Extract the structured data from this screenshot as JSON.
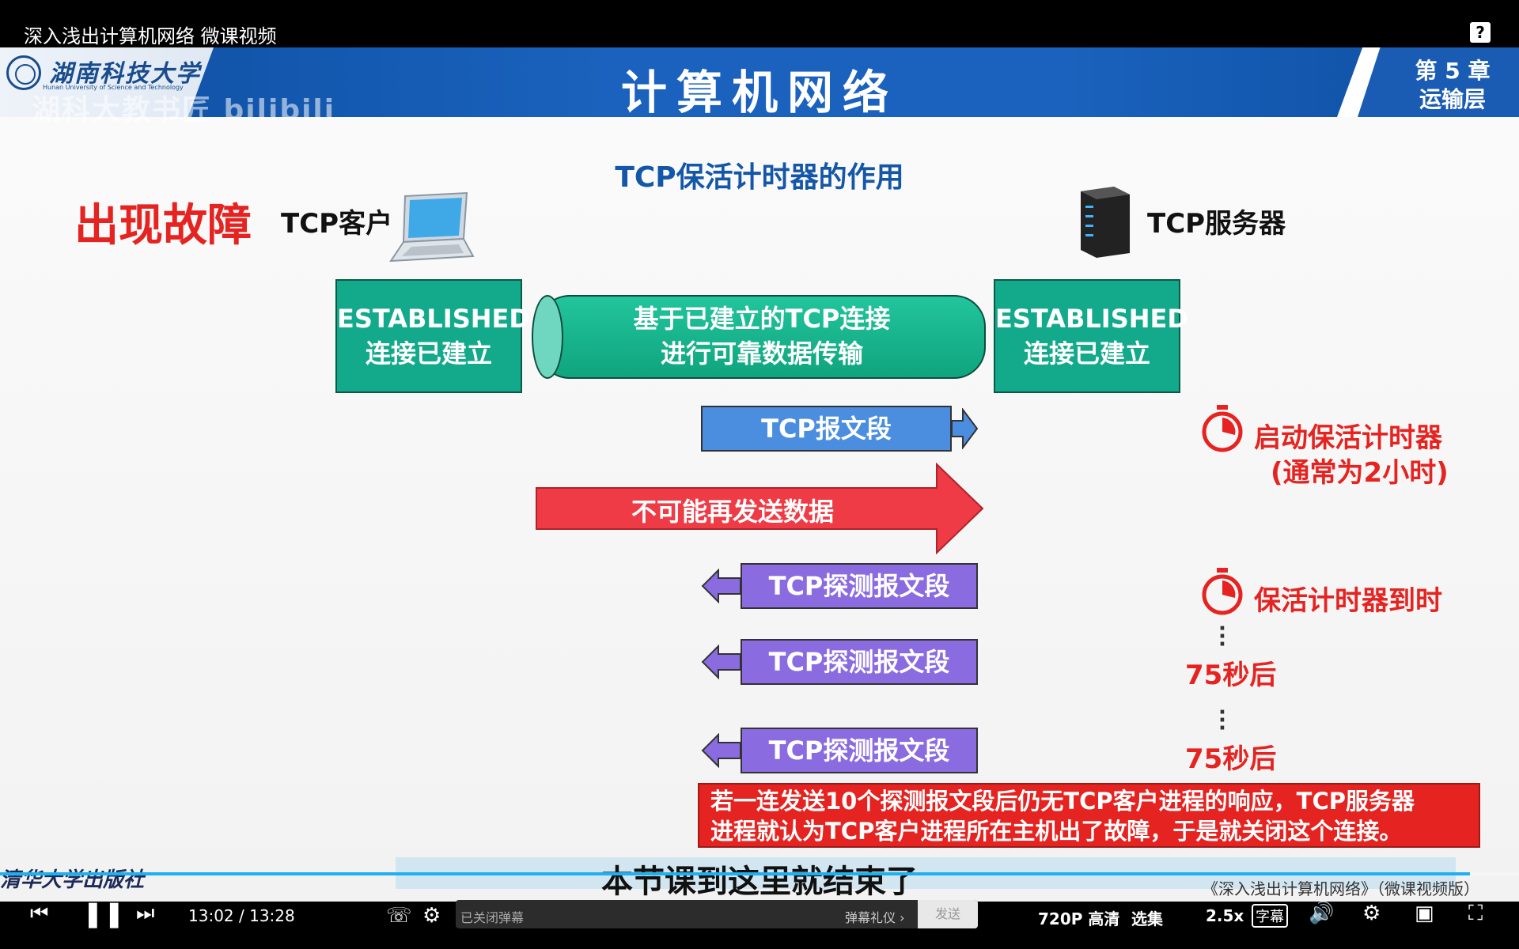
{
  "window": {
    "title": "深入浅出计算机网络 微课视频",
    "help_glyph": "?"
  },
  "slide": {
    "university": "湖南科技大学",
    "university_en": "Hunan University of Science and Technology",
    "watermark": "湖科大教书匠 bilibili",
    "course": "计算机网络",
    "chapter_line1": "第 5 章",
    "chapter_line2": "运输层",
    "title": "TCP保活计时器的作用",
    "fault_label": "出现故障",
    "client_label": "TCP客户",
    "server_label": "TCP服务器",
    "client_state": [
      "ESTABLISHED",
      "连接已建立"
    ],
    "server_state": [
      "ESTABLISHED",
      "连接已建立"
    ],
    "connection": [
      "基于已建立的TCP连接",
      "进行可靠数据传输"
    ],
    "segment": "TCP报文段",
    "cannot_send": "不可能再发送数据",
    "probes": [
      "TCP探测报文段",
      "TCP探测报文段",
      "TCP探测报文段"
    ],
    "timer_start": "启动保活计时器",
    "timer_start_note": "(通常为2小时)",
    "timer_expire": "保活计时器到时",
    "after_75": [
      "75秒后",
      "75秒后"
    ],
    "conclusion": [
      "若一连发送10个探测报文段后仍无TCP客户进程的响应，TCP服务器",
      "进程就认为TCP客户进程所在主机出了故障，于是就关闭这个连接。"
    ],
    "press": "清华大学出版社",
    "book": "《深入浅出计算机网络》（微课视频版）",
    "caption": "本节课到这里就结束了"
  },
  "player": {
    "current_time": "13:02",
    "separator": "/",
    "duration": "13:28",
    "progress": 0.9677,
    "danmaku_placeholder": "已关闭弹幕",
    "danmaku_etiquette": "弹幕礼仪 ›",
    "send": "发送",
    "quality": "720P 高清",
    "episodes": "选集",
    "speed": "2.5x",
    "subtitle_icon": "字幕",
    "icons": [
      "prev-icon",
      "pause-icon",
      "next-icon",
      "danmaku-icon",
      "danmaku-settings-icon",
      "volume-icon",
      "gear-icon",
      "pip-icon",
      "fullscreen-icon"
    ]
  }
}
